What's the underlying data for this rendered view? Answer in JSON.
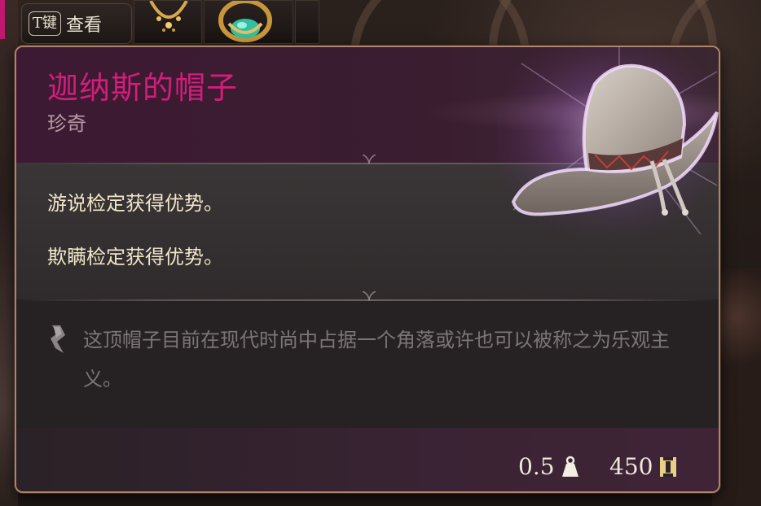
{
  "hotbar": {
    "key_cap": "T键",
    "key_label": "查看"
  },
  "tooltip": {
    "item_name": "迦纳斯的帽子",
    "rarity": "珍奇",
    "effects": [
      "游说检定获得优势。",
      "欺瞒检定获得优势。"
    ],
    "flavor_text": "这顶帽子目前在现代时尚中占据一个角落或许也可以被称之为乐观主义。",
    "weight": "0.5",
    "price": "450",
    "weight_icon": "weight-icon",
    "price_icon": "gold-coin-icon",
    "hat_image": "hat-icon"
  },
  "colors": {
    "item_name": "#d31d7b",
    "rarity": "#b49aa6",
    "effect_text": "#f0e6c8",
    "flavor_text": "#7c7577",
    "border": "#b0846a"
  }
}
